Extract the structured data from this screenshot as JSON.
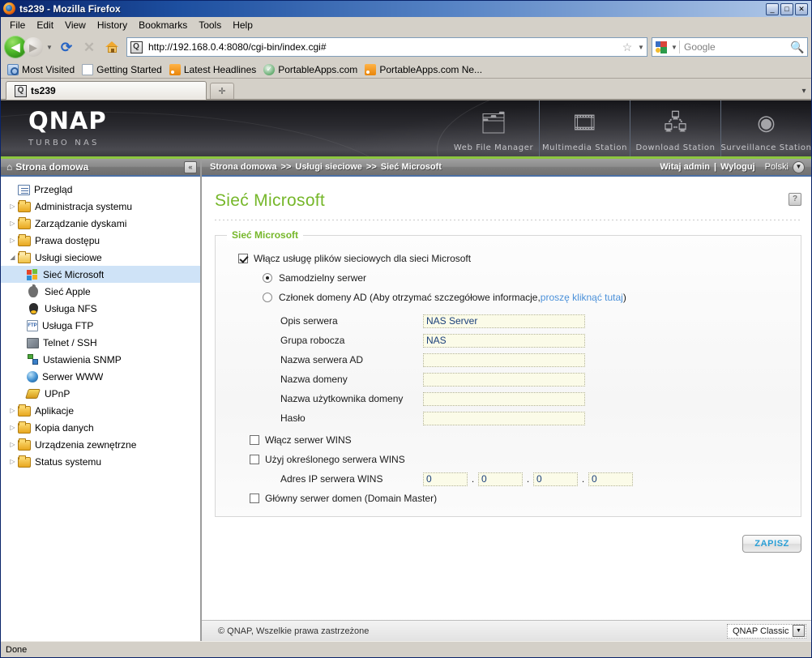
{
  "window": {
    "title": "ts239 - Mozilla Firefox",
    "minimize": "_",
    "maximize": "□",
    "close": "✕"
  },
  "menubar": [
    "File",
    "Edit",
    "View",
    "History",
    "Bookmarks",
    "Tools",
    "Help"
  ],
  "navbar": {
    "back_glyph": "◀",
    "forward_glyph": "▶",
    "dropdown_glyph": "▼",
    "reload_glyph": "⟳",
    "stop_glyph": "✕",
    "url": "http://192.168.0.4:8080/cgi-bin/index.cgi#",
    "star_glyph": "☆",
    "url_caret": "▼",
    "favicon_letter": "Q",
    "search_engine": "Google",
    "search_placeholder": "Google",
    "search_caret": "▼",
    "search_magnifier": "🔍"
  },
  "bookmarks": [
    {
      "label": "Most Visited",
      "icon": "star-folder-icon"
    },
    {
      "label": "Getting Started",
      "icon": "page-icon"
    },
    {
      "label": "Latest Headlines",
      "icon": "rss-icon"
    },
    {
      "label": "PortableApps.com",
      "icon": "check-circle-icon"
    },
    {
      "label": "PortableApps.com Ne...",
      "icon": "rss-icon"
    }
  ],
  "tabs": {
    "active": "ts239",
    "new_tab_glyph": "✛",
    "list_glyph": "▾"
  },
  "qnap_header": {
    "logo": "QNAP",
    "tagline": "TURBO NAS",
    "apps": [
      {
        "label": "Web File Manager",
        "icon": "folder-search-icon",
        "glyph": "🗂"
      },
      {
        "label": "Multimedia Station",
        "icon": "multimedia-icon",
        "glyph": "🎞"
      },
      {
        "label": "Download Station",
        "icon": "download-icon",
        "glyph": "🖧"
      },
      {
        "label": "Surveillance Station",
        "icon": "camera-icon",
        "glyph": "◉"
      }
    ]
  },
  "sidebar": {
    "header": "Strona domowa",
    "home_glyph": "⌂",
    "collapse_glyph": "«",
    "items": [
      {
        "label": "Przegląd",
        "icon": "document-icon",
        "indent": 1,
        "twisty": "",
        "type": "leaf"
      },
      {
        "label": "Administracja systemu",
        "icon": "folder-icon",
        "indent": 0,
        "twisty": "▷",
        "type": "folder"
      },
      {
        "label": "Zarządzanie dyskami",
        "icon": "folder-icon",
        "indent": 0,
        "twisty": "▷",
        "type": "folder"
      },
      {
        "label": "Prawa dostępu",
        "icon": "folder-icon",
        "indent": 0,
        "twisty": "▷",
        "type": "folder"
      },
      {
        "label": "Usługi sieciowe",
        "icon": "folder-open-icon",
        "indent": 0,
        "twisty": "◢",
        "type": "folder-open"
      },
      {
        "label": "Sieć Microsoft",
        "icon": "windows-icon",
        "indent": 2,
        "twisty": "",
        "type": "leaf",
        "selected": true
      },
      {
        "label": "Sieć Apple",
        "icon": "apple-icon",
        "indent": 2,
        "twisty": "",
        "type": "leaf"
      },
      {
        "label": "Usługa NFS",
        "icon": "linux-icon",
        "indent": 2,
        "twisty": "",
        "type": "leaf"
      },
      {
        "label": "Usługa FTP",
        "icon": "ftp-icon",
        "indent": 2,
        "twisty": "",
        "type": "leaf"
      },
      {
        "label": "Telnet / SSH",
        "icon": "terminal-icon",
        "indent": 2,
        "twisty": "",
        "type": "leaf"
      },
      {
        "label": "Ustawienia SNMP",
        "icon": "snmp-icon",
        "indent": 2,
        "twisty": "",
        "type": "leaf"
      },
      {
        "label": "Serwer WWW",
        "icon": "globe-icon",
        "indent": 2,
        "twisty": "",
        "type": "leaf"
      },
      {
        "label": "UPnP",
        "icon": "upnp-icon",
        "indent": 2,
        "twisty": "",
        "type": "leaf"
      },
      {
        "label": "Aplikacje",
        "icon": "folder-icon",
        "indent": 0,
        "twisty": "▷",
        "type": "folder"
      },
      {
        "label": "Kopia danych",
        "icon": "folder-icon",
        "indent": 0,
        "twisty": "▷",
        "type": "folder"
      },
      {
        "label": "Urządzenia zewnętrzne",
        "icon": "folder-icon",
        "indent": 0,
        "twisty": "▷",
        "type": "folder"
      },
      {
        "label": "Status systemu",
        "icon": "folder-icon",
        "indent": 0,
        "twisty": "▷",
        "type": "folder"
      }
    ]
  },
  "breadcrumb": {
    "items": [
      "Strona domowa",
      "Usługi sieciowe",
      "Sieć Microsoft"
    ],
    "separator": ">>",
    "greeting": "Witaj admin",
    "divider": "|",
    "logout": "Wyloguj",
    "language": "Polski",
    "language_caret": "▼"
  },
  "page": {
    "title": "Sieć Microsoft",
    "help_glyph": "?",
    "fieldset_legend": "Sieć Microsoft",
    "enable_checkbox": {
      "label": "Włącz usługę plików sieciowych dla sieci Microsoft",
      "checked": true
    },
    "mode_radios": [
      {
        "label": "Samodzielny serwer",
        "selected": true
      },
      {
        "label_prefix": "Członek domeny AD (Aby otrzymać szczegółowe informacje,",
        "link": "proszę kliknąć tutaj",
        "label_suffix": ")",
        "selected": false
      }
    ],
    "fields": [
      {
        "label": "Opis serwera",
        "value": "NAS Server"
      },
      {
        "label": "Grupa robocza",
        "value": "NAS"
      },
      {
        "label": "Nazwa serwera AD",
        "value": ""
      },
      {
        "label": "Nazwa domeny",
        "value": ""
      },
      {
        "label": "Nazwa użytkownika domeny",
        "value": ""
      },
      {
        "label": "Hasło",
        "value": ""
      }
    ],
    "wins": {
      "enable_wins": {
        "label": "Włącz serwer WINS",
        "checked": false
      },
      "use_specified": {
        "label": "Użyj określonego serwera WINS",
        "checked": false
      },
      "ip_label": "Adres IP serwera WINS",
      "ip_octets": [
        "0",
        "0",
        "0",
        "0"
      ],
      "ip_dot": ".",
      "domain_master": {
        "label": "Główny serwer domen (Domain Master)",
        "checked": false
      }
    },
    "save_button": "ZAPISZ"
  },
  "page_footer": {
    "copyright": "© QNAP, Wszelkie prawa zastrzeżone",
    "theme": "QNAP Classic",
    "theme_caret": "▼"
  },
  "statusbar": {
    "text": "Done"
  },
  "colors": {
    "accent_green": "#76b72a",
    "header_green_bar": "#8cc63e",
    "link_blue": "#4a90d9",
    "save_text_blue": "#2a9fd6",
    "selected_row": "#cfe3f7",
    "input_bg": "#fbfbe8",
    "input_text": "#1a3f7a"
  }
}
